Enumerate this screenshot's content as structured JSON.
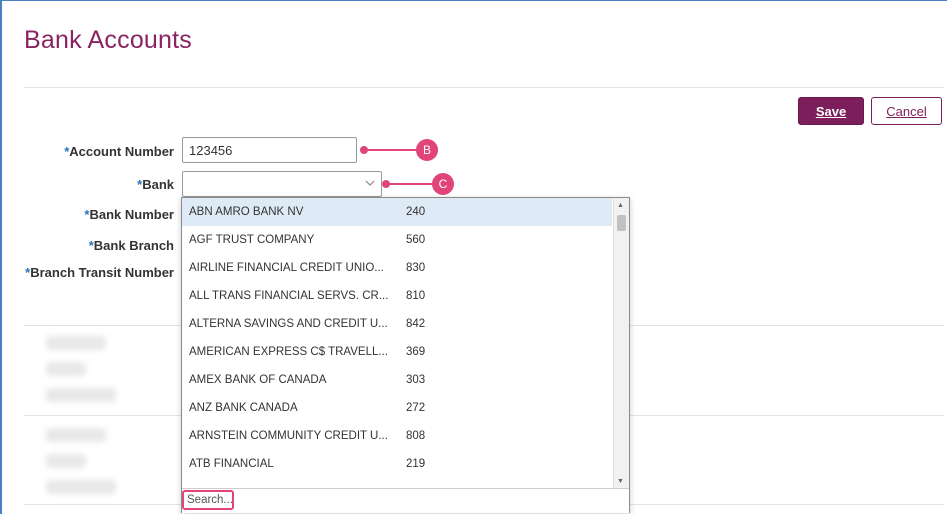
{
  "page": {
    "title": "Bank Accounts"
  },
  "actions": {
    "save_label": "Save",
    "cancel_label": "Cancel"
  },
  "form": {
    "account_number": {
      "label": "Account Number",
      "value": "123456",
      "marker": "B"
    },
    "bank": {
      "label": "Bank",
      "value": "",
      "marker": "C"
    },
    "bank_number": {
      "label": "Bank Number"
    },
    "bank_branch": {
      "label": "Bank Branch"
    },
    "branch_transit_number": {
      "label": "Branch Transit Number"
    },
    "required_marker": "*"
  },
  "dropdown": {
    "items": [
      {
        "name": "ABN AMRO BANK NV",
        "code": "240",
        "selected": true
      },
      {
        "name": "AGF TRUST COMPANY",
        "code": "560"
      },
      {
        "name": "AIRLINE FINANCIAL CREDIT UNIO...",
        "code": "830"
      },
      {
        "name": "ALL TRANS FINANCIAL SERVS. CR...",
        "code": "810"
      },
      {
        "name": "ALTERNA SAVINGS AND CREDIT U...",
        "code": "842"
      },
      {
        "name": "AMERICAN EXPRESS C$ TRAVELL...",
        "code": "369"
      },
      {
        "name": "AMEX BANK OF CANADA",
        "code": "303"
      },
      {
        "name": "ANZ BANK CANADA",
        "code": "272"
      },
      {
        "name": "ARNSTEIN COMMUNITY CREDIT U...",
        "code": "808"
      },
      {
        "name": "ATB FINANCIAL",
        "code": "219"
      }
    ],
    "search_placeholder": "Search..."
  },
  "colors": {
    "brand": "#7d1e5c",
    "title": "#8a2462",
    "marker": "#e0447a",
    "required": "#2a74b6"
  }
}
